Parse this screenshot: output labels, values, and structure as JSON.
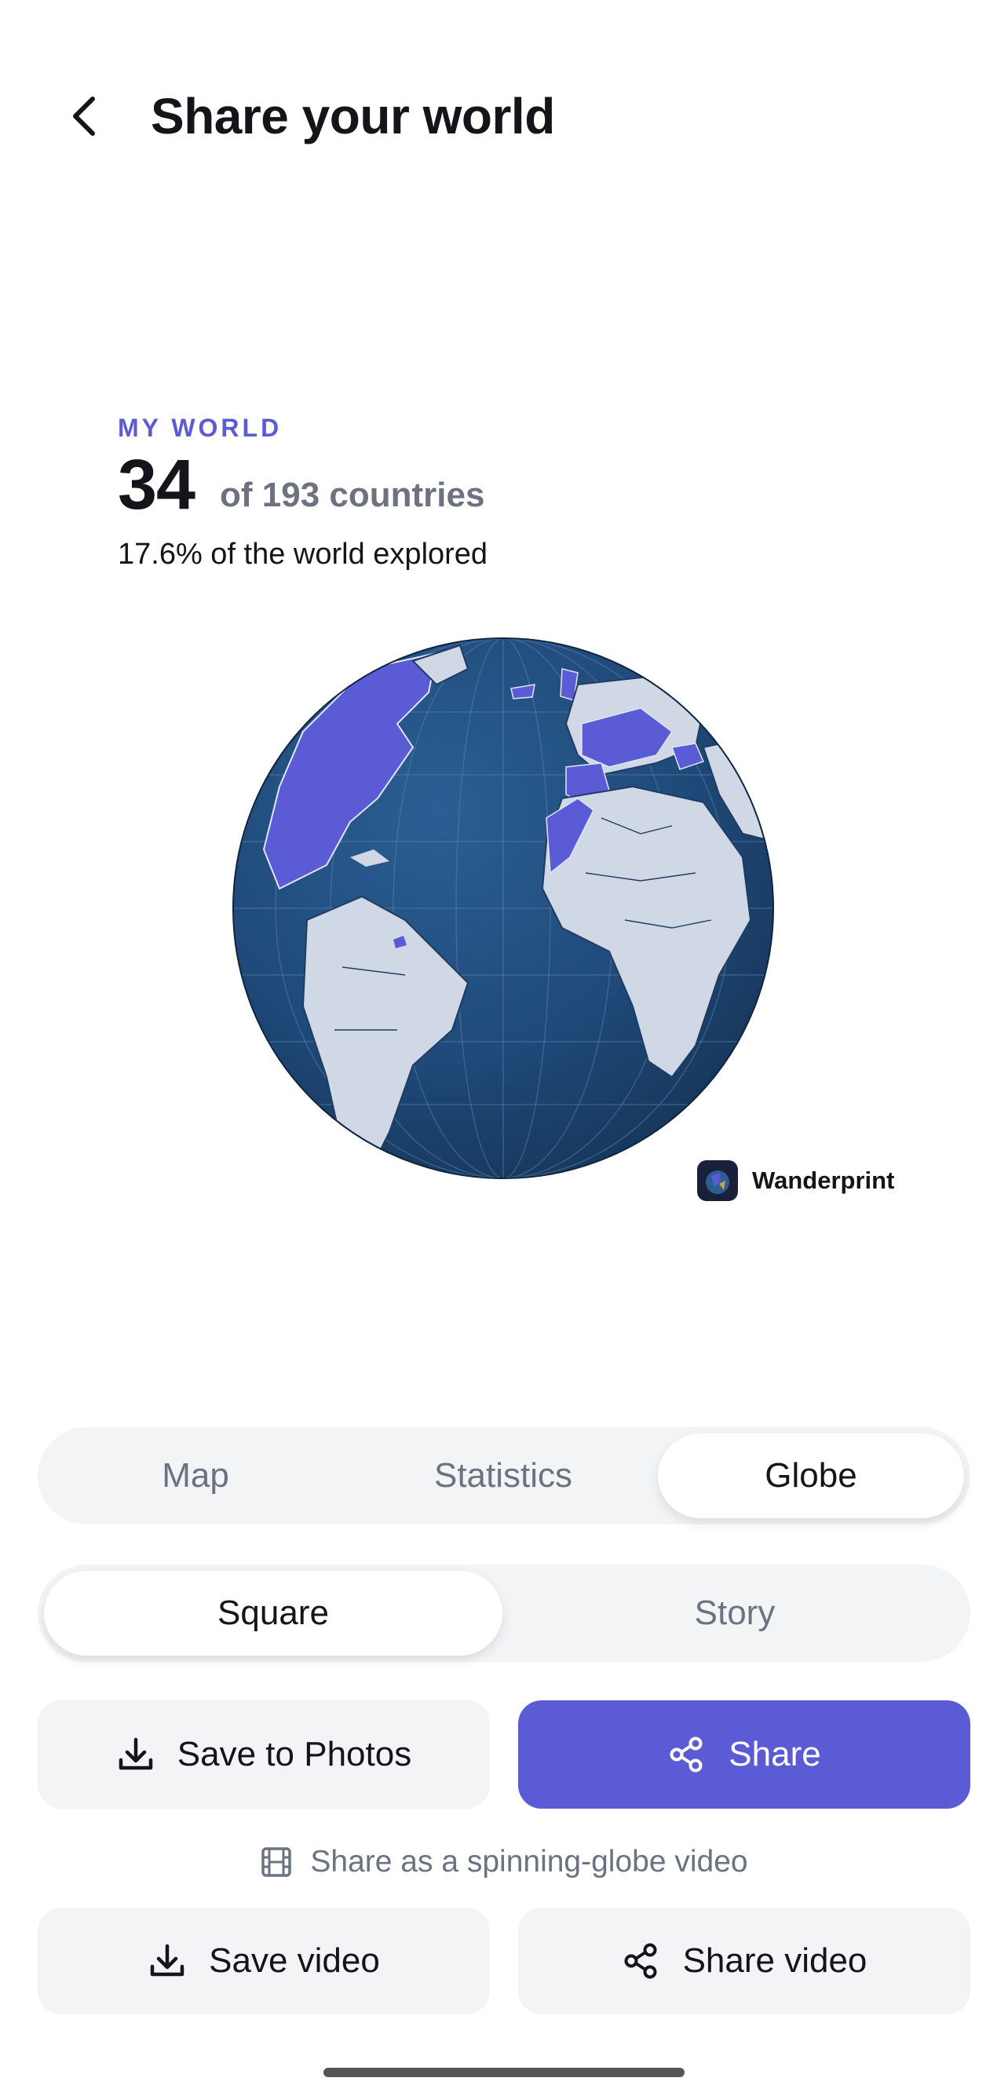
{
  "header": {
    "title": "Share your world"
  },
  "card": {
    "eyebrow": "MY WORLD",
    "count": "34",
    "of_total": "of 193 countries",
    "percent_text": "17.6% of the world explored",
    "brand_name": "Wanderprint"
  },
  "view_tabs": [
    {
      "label": "Map",
      "active": false
    },
    {
      "label": "Statistics",
      "active": false
    },
    {
      "label": "Globe",
      "active": true
    }
  ],
  "format_tabs": [
    {
      "label": "Square",
      "active": true
    },
    {
      "label": "Story",
      "active": false
    }
  ],
  "actions": {
    "save_photos": "Save to Photos",
    "share": "Share",
    "video_hint": "Share as a spinning-globe video",
    "save_video": "Save video",
    "share_video": "Share video"
  },
  "colors": {
    "accent": "#5b5bd6",
    "ocean": "#1f4a7a",
    "land": "#cfd8e4",
    "visited": "#5b5bd6"
  },
  "icons": [
    "chevron-left-icon",
    "download-icon",
    "share-icon",
    "film-icon"
  ]
}
